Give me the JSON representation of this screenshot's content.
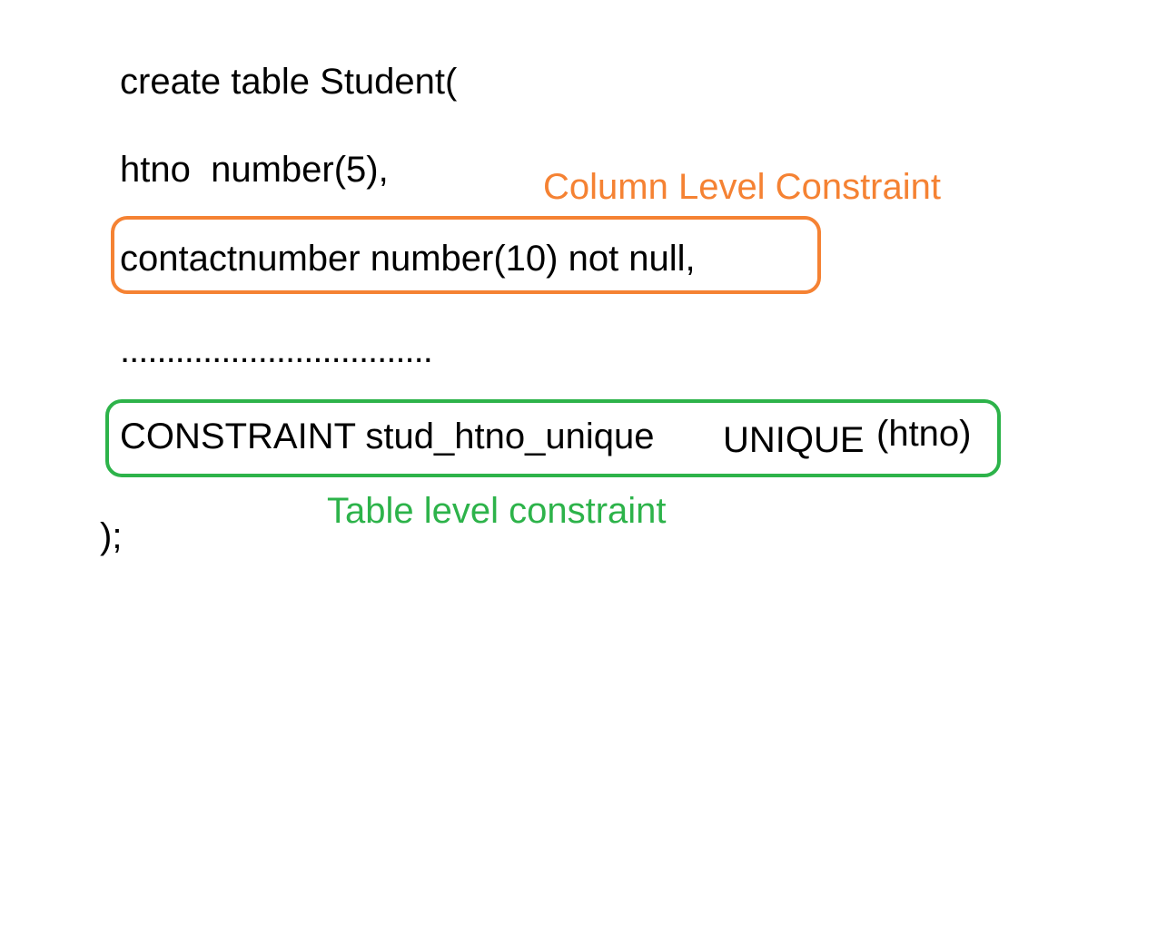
{
  "code": {
    "line1": "create table Student(",
    "line2": "htno  number(5),",
    "line3": "contactnumber number(10) not null,",
    "line4": "..................................",
    "line5_prefix": "CONSTRAINT stud_htno_unique",
    "line5_keyword": "UNIQUE",
    "line5_arg": "(htno)",
    "line6": ");"
  },
  "annotations": {
    "column_label": "Column Level Constraint",
    "table_label": "Table level constraint"
  },
  "colors": {
    "column_accent": "#f58233",
    "table_accent": "#2db34a",
    "text": "#000000",
    "background": "#ffffff"
  }
}
